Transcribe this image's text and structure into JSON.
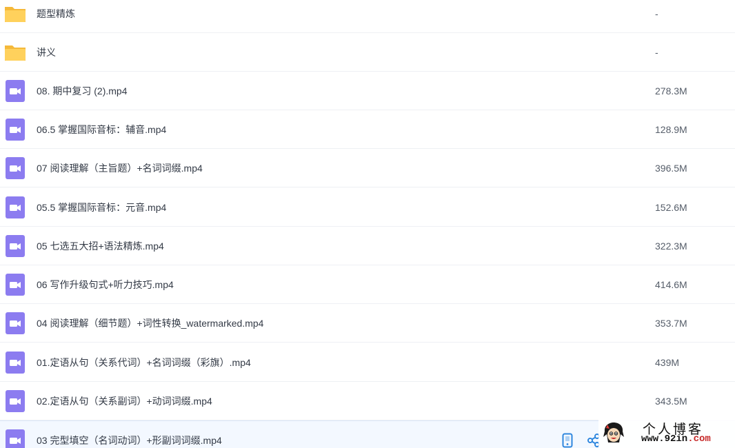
{
  "colors": {
    "folder": "#FFD15C",
    "folder_tab": "#F5B93A",
    "video": "#8C7CF0",
    "selected_row": "#F3F8FF",
    "action_icon": "#2E86DE"
  },
  "files": [
    {
      "name": "题型精炼",
      "size": "-",
      "icon": "folder-icon"
    },
    {
      "name": "讲义",
      "size": "-",
      "icon": "folder-icon"
    },
    {
      "name": "08. 期中复习 (2).mp4",
      "size": "278.3M",
      "icon": "video-file-icon"
    },
    {
      "name": "06.5 掌握国际音标：辅音.mp4",
      "size": "128.9M",
      "icon": "video-file-icon"
    },
    {
      "name": "07 阅读理解（主旨题）+名词词缀.mp4",
      "size": "396.5M",
      "icon": "video-file-icon"
    },
    {
      "name": "05.5 掌握国际音标：元音.mp4",
      "size": "152.6M",
      "icon": "video-file-icon"
    },
    {
      "name": "05 七选五大招+语法精炼.mp4",
      "size": "322.3M",
      "icon": "video-file-icon"
    },
    {
      "name": "06 写作升级句式+听力技巧.mp4",
      "size": "414.6M",
      "icon": "video-file-icon"
    },
    {
      "name": "04 阅读理解（细节题）+词性转换_watermarked.mp4",
      "size": "353.7M",
      "icon": "video-file-icon"
    },
    {
      "name": "01.定语从句（关系代词）+名词词缀（彩旗）.mp4",
      "size": "439M",
      "icon": "video-file-icon"
    },
    {
      "name": "02.定语从句（关系副词）+动词词缀.mp4",
      "size": "343.5M",
      "icon": "video-file-icon"
    },
    {
      "name": "03 完型填空（名词动词）+形副词词缀.mp4",
      "size": "",
      "icon": "video-file-icon",
      "selected": true
    }
  ],
  "row_actions": [
    {
      "icon": "phone-icon"
    },
    {
      "icon": "share-icon"
    }
  ],
  "watermark": {
    "title": "个人博客",
    "url_main": "www.92in",
    "url_tld": ".com"
  }
}
